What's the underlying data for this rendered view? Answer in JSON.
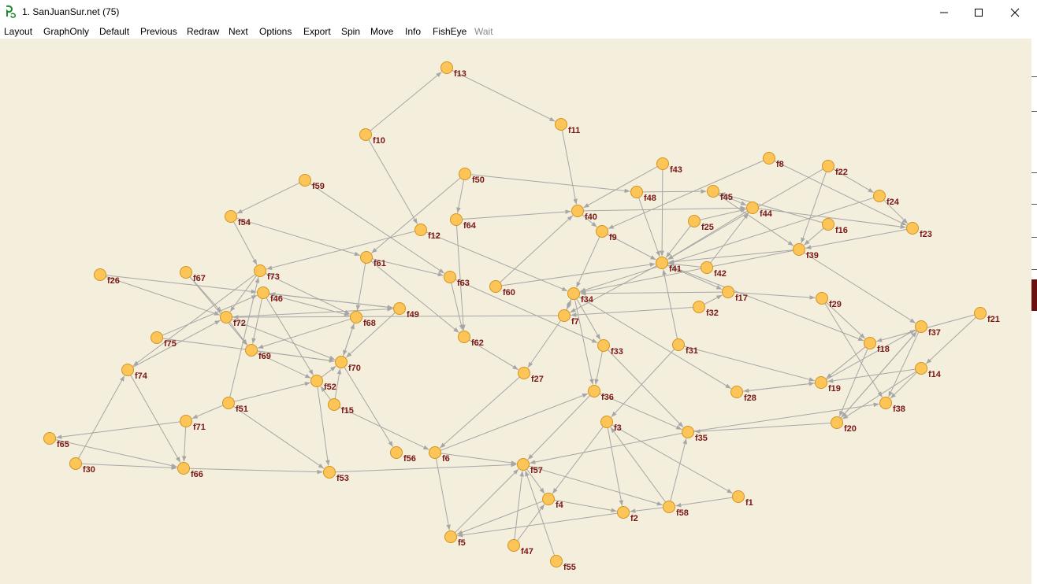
{
  "window": {
    "title": "1. SanJuanSur.net (75)",
    "icon": "pajek-app-icon",
    "controls": [
      "minimize-icon",
      "maximize-icon",
      "close-icon"
    ]
  },
  "menu": {
    "items": [
      {
        "label": "Layout",
        "enabled": true
      },
      {
        "label": "GraphOnly",
        "enabled": true
      },
      {
        "label": "Default",
        "enabled": true
      },
      {
        "label": "Previous",
        "enabled": true
      },
      {
        "label": "Redraw",
        "enabled": true
      },
      {
        "label": "Next",
        "enabled": true
      },
      {
        "label": "Options",
        "enabled": true
      },
      {
        "label": "Export",
        "enabled": true
      },
      {
        "label": "Spin",
        "enabled": true
      },
      {
        "label": "Move",
        "enabled": true
      },
      {
        "label": "Info",
        "enabled": true
      },
      {
        "label": "FishEye",
        "enabled": true
      },
      {
        "label": "Wait",
        "enabled": false
      }
    ]
  },
  "colors": {
    "canvas": "#f3efdc",
    "node_fill": "#fdc458",
    "node_stroke": "#d2941e",
    "label": "#7a1616",
    "edge": "#a6a6a6"
  },
  "nodes": [
    {
      "id": "f13"
    },
    {
      "id": "f11"
    },
    {
      "id": "f10"
    },
    {
      "id": "f8"
    },
    {
      "id": "f22"
    },
    {
      "id": "f43"
    },
    {
      "id": "f50"
    },
    {
      "id": "f48"
    },
    {
      "id": "f45"
    },
    {
      "id": "f24"
    },
    {
      "id": "f59"
    },
    {
      "id": "f40"
    },
    {
      "id": "f44"
    },
    {
      "id": "f54"
    },
    {
      "id": "f64"
    },
    {
      "id": "f25"
    },
    {
      "id": "f16"
    },
    {
      "id": "f23"
    },
    {
      "id": "f9"
    },
    {
      "id": "f12"
    },
    {
      "id": "f39"
    },
    {
      "id": "f61"
    },
    {
      "id": "f41"
    },
    {
      "id": "f42"
    },
    {
      "id": "f26"
    },
    {
      "id": "f67"
    },
    {
      "id": "f73"
    },
    {
      "id": "f63"
    },
    {
      "id": "f60"
    },
    {
      "id": "f46"
    },
    {
      "id": "f34"
    },
    {
      "id": "f17"
    },
    {
      "id": "f29"
    },
    {
      "id": "f49"
    },
    {
      "id": "f32"
    },
    {
      "id": "f72"
    },
    {
      "id": "f68"
    },
    {
      "id": "f7"
    },
    {
      "id": "f21"
    },
    {
      "id": "f37"
    },
    {
      "id": "f75"
    },
    {
      "id": "f62"
    },
    {
      "id": "f33"
    },
    {
      "id": "f31"
    },
    {
      "id": "f18"
    },
    {
      "id": "f69"
    },
    {
      "id": "f70"
    },
    {
      "id": "f74"
    },
    {
      "id": "f27"
    },
    {
      "id": "f14"
    },
    {
      "id": "f52"
    },
    {
      "id": "f19"
    },
    {
      "id": "f36"
    },
    {
      "id": "f28"
    },
    {
      "id": "f51"
    },
    {
      "id": "f15"
    },
    {
      "id": "f38"
    },
    {
      "id": "f71"
    },
    {
      "id": "f3"
    },
    {
      "id": "f20"
    },
    {
      "id": "f35"
    },
    {
      "id": "f65"
    },
    {
      "id": "f56"
    },
    {
      "id": "f6"
    },
    {
      "id": "f30"
    },
    {
      "id": "f57"
    },
    {
      "id": "f66"
    },
    {
      "id": "f53"
    },
    {
      "id": "f1"
    },
    {
      "id": "f4"
    },
    {
      "id": "f58"
    },
    {
      "id": "f2"
    },
    {
      "id": "f5"
    },
    {
      "id": "f47"
    },
    {
      "id": "f55"
    }
  ],
  "edges": [
    [
      "f10",
      "f13"
    ],
    [
      "f13",
      "f11"
    ],
    [
      "f11",
      "f40"
    ],
    [
      "f10",
      "f12"
    ],
    [
      "f8",
      "f23"
    ],
    [
      "f8",
      "f9"
    ],
    [
      "f22",
      "f39"
    ],
    [
      "f22",
      "f24"
    ],
    [
      "f22",
      "f41"
    ],
    [
      "f43",
      "f41"
    ],
    [
      "f43",
      "f40"
    ],
    [
      "f50",
      "f48"
    ],
    [
      "f50",
      "f64"
    ],
    [
      "f50",
      "f61"
    ],
    [
      "f48",
      "f45"
    ],
    [
      "f48",
      "f41"
    ],
    [
      "f45",
      "f44"
    ],
    [
      "f45",
      "f39"
    ],
    [
      "f24",
      "f23"
    ],
    [
      "f24",
      "f34"
    ],
    [
      "f59",
      "f54"
    ],
    [
      "f59",
      "f63"
    ],
    [
      "f40",
      "f44"
    ],
    [
      "f40",
      "f9"
    ],
    [
      "f44",
      "f41"
    ],
    [
      "f44",
      "f23"
    ],
    [
      "f54",
      "f61"
    ],
    [
      "f54",
      "f73"
    ],
    [
      "f64",
      "f62"
    ],
    [
      "f64",
      "f40"
    ],
    [
      "f25",
      "f41"
    ],
    [
      "f25",
      "f44"
    ],
    [
      "f16",
      "f39"
    ],
    [
      "f16",
      "f45"
    ],
    [
      "f23",
      "f39"
    ],
    [
      "f9",
      "f41"
    ],
    [
      "f9",
      "f34"
    ],
    [
      "f12",
      "f34"
    ],
    [
      "f12",
      "f73"
    ],
    [
      "f39",
      "f41"
    ],
    [
      "f39",
      "f34"
    ],
    [
      "f39",
      "f37"
    ],
    [
      "f61",
      "f63"
    ],
    [
      "f61",
      "f68"
    ],
    [
      "f61",
      "f62"
    ],
    [
      "f41",
      "f17"
    ],
    [
      "f41",
      "f18"
    ],
    [
      "f41",
      "f7"
    ],
    [
      "f42",
      "f44"
    ],
    [
      "f42",
      "f41"
    ],
    [
      "f26",
      "f46"
    ],
    [
      "f26",
      "f72"
    ],
    [
      "f67",
      "f72"
    ],
    [
      "f67",
      "f69"
    ],
    [
      "f73",
      "f68"
    ],
    [
      "f73",
      "f72"
    ],
    [
      "f73",
      "f74"
    ],
    [
      "f63",
      "f33"
    ],
    [
      "f63",
      "f62"
    ],
    [
      "f60",
      "f40"
    ],
    [
      "f60",
      "f41"
    ],
    [
      "f46",
      "f49"
    ],
    [
      "f46",
      "f52"
    ],
    [
      "f46",
      "f68"
    ],
    [
      "f46",
      "f69"
    ],
    [
      "f34",
      "f33"
    ],
    [
      "f34",
      "f28"
    ],
    [
      "f34",
      "f36"
    ],
    [
      "f34",
      "f7"
    ],
    [
      "f17",
      "f29"
    ],
    [
      "f17",
      "f34"
    ],
    [
      "f29",
      "f18"
    ],
    [
      "f29",
      "f38"
    ],
    [
      "f49",
      "f46"
    ],
    [
      "f49",
      "f70"
    ],
    [
      "f32",
      "f7"
    ],
    [
      "f32",
      "f17"
    ],
    [
      "f72",
      "f70"
    ],
    [
      "f72",
      "f49"
    ],
    [
      "f72",
      "f69"
    ],
    [
      "f68",
      "f70"
    ],
    [
      "f68",
      "f69"
    ],
    [
      "f7",
      "f27"
    ],
    [
      "f7",
      "f34"
    ],
    [
      "f7",
      "f72"
    ],
    [
      "f21",
      "f18"
    ],
    [
      "f21",
      "f14"
    ],
    [
      "f37",
      "f38"
    ],
    [
      "f37",
      "f20"
    ],
    [
      "f75",
      "f70"
    ],
    [
      "f75",
      "f46"
    ],
    [
      "f62",
      "f27"
    ],
    [
      "f33",
      "f35"
    ],
    [
      "f33",
      "f36"
    ],
    [
      "f31",
      "f19"
    ],
    [
      "f31",
      "f3"
    ],
    [
      "f31",
      "f41"
    ],
    [
      "f18",
      "f19"
    ],
    [
      "f18",
      "f20"
    ],
    [
      "f69",
      "f70"
    ],
    [
      "f69",
      "f52"
    ],
    [
      "f70",
      "f56"
    ],
    [
      "f70",
      "f68"
    ],
    [
      "f74",
      "f66"
    ],
    [
      "f74",
      "f72"
    ],
    [
      "f27",
      "f6"
    ],
    [
      "f14",
      "f38"
    ],
    [
      "f14",
      "f19"
    ],
    [
      "f14",
      "f20"
    ],
    [
      "f52",
      "f70"
    ],
    [
      "f52",
      "f53"
    ],
    [
      "f19",
      "f28"
    ],
    [
      "f19",
      "f37"
    ],
    [
      "f36",
      "f57"
    ],
    [
      "f36",
      "f35"
    ],
    [
      "f28",
      "f19"
    ],
    [
      "f51",
      "f52"
    ],
    [
      "f51",
      "f71"
    ],
    [
      "f51",
      "f53"
    ],
    [
      "f51",
      "f73"
    ],
    [
      "f15",
      "f70"
    ],
    [
      "f15",
      "f6"
    ],
    [
      "f15",
      "f52"
    ],
    [
      "f71",
      "f66"
    ],
    [
      "f71",
      "f65"
    ],
    [
      "f3",
      "f4"
    ],
    [
      "f3",
      "f2"
    ],
    [
      "f3",
      "f1"
    ],
    [
      "f20",
      "f37"
    ],
    [
      "f20",
      "f35"
    ],
    [
      "f35",
      "f57"
    ],
    [
      "f35",
      "f38"
    ],
    [
      "f65",
      "f66"
    ],
    [
      "f30",
      "f66"
    ],
    [
      "f30",
      "f74"
    ],
    [
      "f6",
      "f5"
    ],
    [
      "f6",
      "f57"
    ],
    [
      "f6",
      "f36"
    ],
    [
      "f57",
      "f4"
    ],
    [
      "f57",
      "f58"
    ],
    [
      "f66",
      "f53"
    ],
    [
      "f53",
      "f57"
    ],
    [
      "f1",
      "f58"
    ],
    [
      "f4",
      "f2"
    ],
    [
      "f4",
      "f5"
    ],
    [
      "f58",
      "f35"
    ],
    [
      "f58",
      "f2"
    ],
    [
      "f58",
      "f3"
    ],
    [
      "f2",
      "f5"
    ],
    [
      "f5",
      "f57"
    ],
    [
      "f47",
      "f57"
    ],
    [
      "f47",
      "f4"
    ],
    [
      "f55",
      "f57"
    ]
  ]
}
